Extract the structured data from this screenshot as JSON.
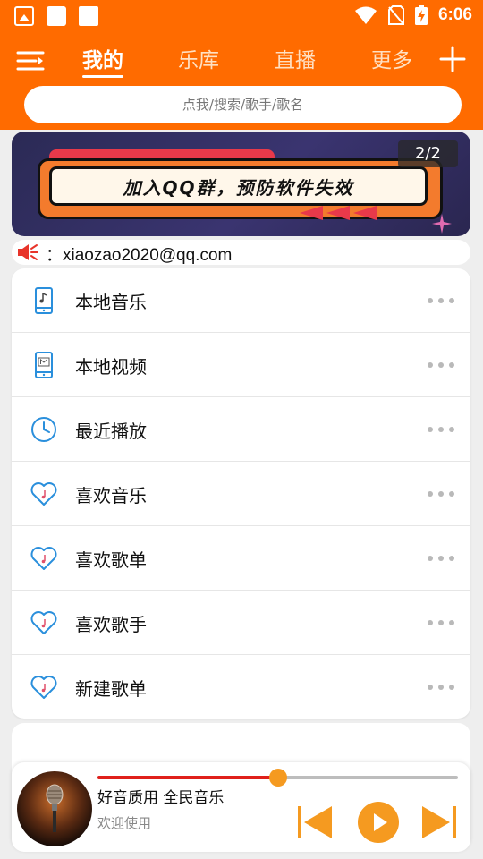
{
  "status_bar": {
    "time": "6:06"
  },
  "nav": {
    "tabs": [
      {
        "label": "我的",
        "active": true
      },
      {
        "label": "乐库",
        "active": false
      },
      {
        "label": "直播",
        "active": false
      },
      {
        "label": "更多",
        "active": false
      }
    ]
  },
  "search": {
    "placeholder": "点我/搜索/歌手/歌名"
  },
  "banner": {
    "text": "加入QQ群，预防软件失效",
    "counter": "2/2"
  },
  "notice": {
    "text": "：xiaozao2020@qq.com"
  },
  "menu": {
    "items": [
      {
        "label": "本地音乐",
        "icon": "phone-music-icon"
      },
      {
        "label": "本地视频",
        "icon": "phone-video-icon"
      },
      {
        "label": "最近播放",
        "icon": "clock-icon"
      },
      {
        "label": "喜欢音乐",
        "icon": "heart-music-icon"
      },
      {
        "label": "喜欢歌单",
        "icon": "heart-music-icon"
      },
      {
        "label": "喜欢歌手",
        "icon": "heart-music-icon"
      },
      {
        "label": "新建歌单",
        "icon": "heart-music-icon"
      }
    ]
  },
  "player": {
    "title": "好音质用 全民音乐",
    "subtitle": "欢迎使用",
    "progress": 0.5
  },
  "colors": {
    "accent": "#ff6b00",
    "icon_blue": "#2a8fdc",
    "progress_red": "#e0201b",
    "control_orange": "#f59a20"
  }
}
